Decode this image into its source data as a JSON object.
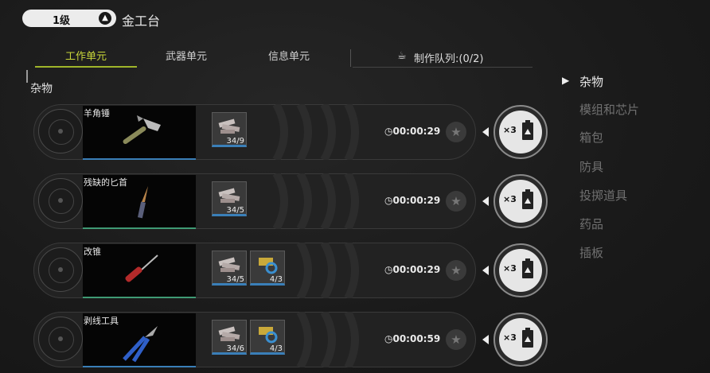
{
  "header": {
    "level": "1级",
    "station_name": "金工台"
  },
  "tabs": [
    {
      "label": "工作单元"
    },
    {
      "label": "武器单元"
    },
    {
      "label": "信息单元"
    }
  ],
  "queue": {
    "label": "制作队列:(0/2)"
  },
  "section": {
    "title": "杂物"
  },
  "recipes": [
    {
      "name": "羊角锤",
      "materials": [
        {
          "icon": "scrap-metal-icon",
          "qty": "34/9"
        }
      ],
      "timer": "00:00:29",
      "craft_multiplier": "×3"
    },
    {
      "name": "残缺的匕首",
      "materials": [
        {
          "icon": "scrap-metal-icon",
          "qty": "34/5"
        }
      ],
      "timer": "00:00:29",
      "craft_multiplier": "×3"
    },
    {
      "name": "改锥",
      "materials": [
        {
          "icon": "scrap-metal-icon",
          "qty": "34/5"
        },
        {
          "icon": "wire-parts-icon",
          "qty": "4/3"
        }
      ],
      "timer": "00:00:29",
      "craft_multiplier": "×3"
    },
    {
      "name": "剥线工具",
      "materials": [
        {
          "icon": "scrap-metal-icon",
          "qty": "34/6"
        },
        {
          "icon": "wire-parts-icon",
          "qty": "4/3"
        }
      ],
      "timer": "00:00:59",
      "craft_multiplier": "×3"
    }
  ],
  "categories": [
    {
      "label": "杂物",
      "active": true
    },
    {
      "label": "模组和芯片"
    },
    {
      "label": "箱包"
    },
    {
      "label": "防具"
    },
    {
      "label": "投掷道具"
    },
    {
      "label": "药品"
    },
    {
      "label": "插板"
    }
  ],
  "colors": {
    "accent": "#c8d63a",
    "bar_blue": "#3a7fb8",
    "bar_green": "#3f9a74"
  }
}
